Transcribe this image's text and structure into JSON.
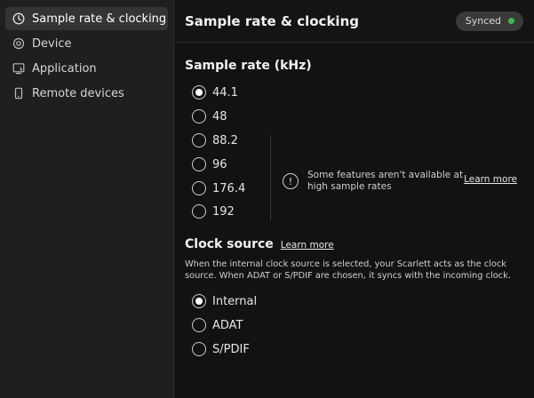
{
  "sidebar": {
    "items": [
      {
        "label": "Sample rate & clocking",
        "icon": "clock-icon",
        "active": true
      },
      {
        "label": "Device",
        "icon": "device-icon",
        "active": false
      },
      {
        "label": "Application",
        "icon": "application-icon",
        "active": false
      },
      {
        "label": "Remote devices",
        "icon": "phone-icon",
        "active": false
      }
    ]
  },
  "header": {
    "title": "Sample rate & clocking",
    "status_label": "Synced",
    "status_color": "#3fb950"
  },
  "sample_rate": {
    "title": "Sample rate (kHz)",
    "options": [
      "44.1",
      "48",
      "88.2",
      "96",
      "176.4",
      "192"
    ],
    "selected": "44.1",
    "notice": {
      "icon": "info-icon",
      "icon_glyph": "!",
      "message": "Some features aren't available at high sample rates",
      "link_label": "Learn more"
    }
  },
  "clock_source": {
    "title": "Clock source",
    "link_label": "Learn more",
    "description": "When the internal clock source is selected, your Scarlett acts as the clock source. When ADAT or S/PDIF are chosen, it syncs with the incoming clock.",
    "options": [
      "Internal",
      "ADAT",
      "S/PDIF"
    ],
    "selected": "Internal"
  }
}
